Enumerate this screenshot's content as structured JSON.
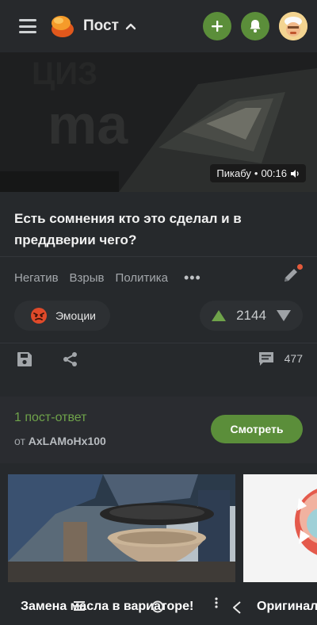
{
  "header": {
    "section_title": "Пост",
    "icons": [
      "menu-icon",
      "logo-icon",
      "chevron-up-icon",
      "plus-icon",
      "bell-icon",
      "avatar"
    ]
  },
  "video": {
    "source": "Пикабу",
    "duration": "00:16"
  },
  "post": {
    "title": "Есть сомнения кто это сделал и в преддверии чего?",
    "tags": [
      "Негатив",
      "Взрыв",
      "Политика"
    ],
    "more": "•••",
    "emotion_label": "Эмоции",
    "rating": "2144",
    "comments_count": "477"
  },
  "reply": {
    "title": "1 пост-ответ",
    "from_label": "от",
    "author": "AxLAMoHx100",
    "button": "Смотреть"
  },
  "carousel": {
    "items": [
      {
        "title": "Замена масла в вариаторе!"
      },
      {
        "title": "Оригинал"
      }
    ]
  },
  "colors": {
    "accent_green": "#5b8e3a",
    "background": "#26292c",
    "rating_up": "#6fa34a"
  }
}
